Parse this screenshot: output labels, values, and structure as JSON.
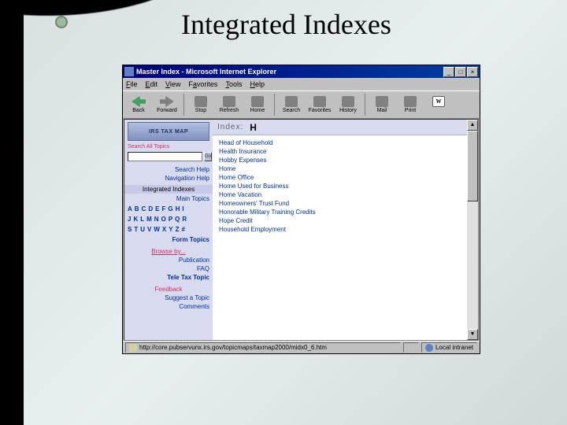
{
  "slide": {
    "title": "Integrated Indexes"
  },
  "browser": {
    "window_title": "Master Index - Microsoft Internet Explorer",
    "menus": [
      "File",
      "Edit",
      "View",
      "Favorites",
      "Tools",
      "Help"
    ],
    "toolbar": {
      "back": "Back",
      "forward": "Forward",
      "stop": "Stop",
      "refresh": "Refresh",
      "home": "Home",
      "search": "Search",
      "favorites": "Favorites",
      "history": "History",
      "mail": "Mail",
      "print": "Print",
      "edit": "W"
    },
    "status_url": "http://core.pubservunx.irs.gov/topicmaps/taxmap2000/midx0_6.htm",
    "status_zone": "Local intranet"
  },
  "sidebar": {
    "banner": "IRS TAX MAP",
    "search_label": "Search All Topics",
    "search_value": "",
    "go": "Go",
    "search_help": "Search Help",
    "nav_help": "Navigation Help",
    "section_indexes": "Integrated Indexes",
    "main_topics": "Main Topics",
    "alpha_row1": [
      "A",
      "B",
      "C",
      "D",
      "E",
      "F",
      "G",
      "H",
      "I"
    ],
    "alpha_row2": [
      "J",
      "K",
      "L",
      "M",
      "N",
      "O",
      "P",
      "Q",
      "R"
    ],
    "alpha_row3": [
      "S",
      "T",
      "U",
      "V",
      "W",
      "X",
      "Y",
      "Z",
      "#"
    ],
    "form_topics": "Form Topics",
    "browse_by": "Browse by...",
    "publication": "Publication",
    "faq": "FAQ",
    "teletax": "Tele Tax Topic",
    "feedback": "Feedback",
    "suggest": "Suggest a Topic",
    "comments": "Comments"
  },
  "main": {
    "index_label": "Index:",
    "letter": "H",
    "items": [
      "Head of Household",
      "Health Insurance",
      "Hobby Expenses",
      "Home",
      "Home Office",
      "Home Used for Business",
      "Home Vacation",
      "Homeowners' Trust Fund",
      "Honorable Military Training Credits",
      "Hope Credit",
      "Household Employment"
    ]
  }
}
